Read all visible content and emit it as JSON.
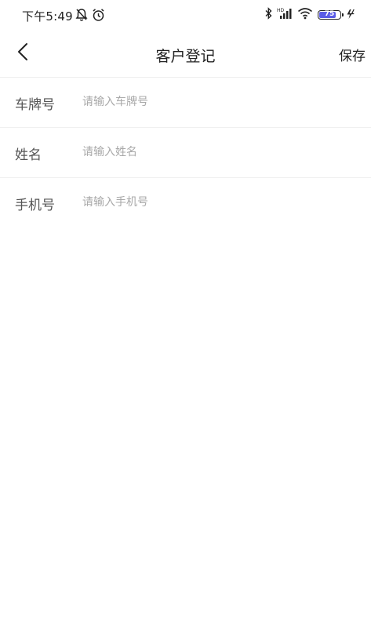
{
  "status_bar": {
    "time": "下午5:49",
    "battery_level": "75",
    "battery_color": "#5a5ce6",
    "icons": [
      "bell-off-icon",
      "alarm-icon",
      "bluetooth-icon",
      "signal-icon",
      "wifi-icon",
      "battery-icon",
      "charging-icon"
    ]
  },
  "navbar": {
    "title": "客户登记",
    "save_label": "保存"
  },
  "form": {
    "fields": [
      {
        "label": "车牌号",
        "placeholder": "请输入车牌号",
        "value": ""
      },
      {
        "label": "姓名",
        "placeholder": "请输入姓名",
        "value": ""
      },
      {
        "label": "手机号",
        "placeholder": "请输入手机号",
        "value": ""
      }
    ]
  }
}
